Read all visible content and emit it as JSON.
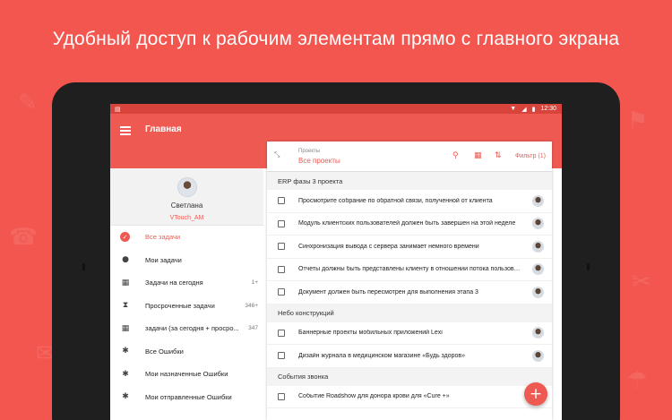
{
  "headline": "Удобный доступ к рабочим элементам прямо с главного экрана",
  "status_bar": {
    "time": "12:30",
    "left_icon": "notification-icon",
    "wifi_icon": "wifi-icon",
    "signal_icon": "signal-icon",
    "battery_icon": "battery-icon"
  },
  "app_bar": {
    "title": "Главная"
  },
  "profile": {
    "name": "Светлана",
    "subtitle": "VTouch_AM"
  },
  "nav": [
    {
      "label": "Все задачи",
      "icon": "check-circle-icon",
      "count": "",
      "active": true
    },
    {
      "label": "Мои задачи",
      "icon": "person-icon",
      "count": ""
    },
    {
      "label": "Задачи на сегодня",
      "icon": "calendar-icon",
      "count": "1+"
    },
    {
      "label": "Просроченные задачи",
      "icon": "hourglass-icon",
      "count": "346+"
    },
    {
      "label": "задачи (за сегодня + просро...",
      "icon": "calendar-check-icon",
      "count": "347"
    },
    {
      "label": "Все Ошибки",
      "icon": "bug-icon",
      "count": ""
    },
    {
      "label": "Мои назначенные Ошибки",
      "icon": "bug-icon",
      "count": ""
    },
    {
      "label": "Мои отправленные Ошибки",
      "icon": "bug-icon",
      "count": ""
    }
  ],
  "panel": {
    "label": "Проекты",
    "value": "Все проекты",
    "filter": "Фильтр (1)",
    "groups": [
      {
        "name": "ERP фазы 3 проекта",
        "tasks": [
          "Просмотрите собрание по обратной связи, полученной от клиента",
          "Модуль клиентских пользователей должен быть завершен на этой неделе",
          "Синхронизация вывода с сервера занимает немного времени",
          "Отчеты должны быть представлены клиенту в отношении потока пользователей",
          "Документ должен быть пересмотрен для выполнения этапа 3"
        ]
      },
      {
        "name": "Небо конструкций",
        "tasks": [
          "Баннерные проекты мобильных приложений Lexi",
          "Дизайн журнала в медицинском магазине «Будь здоров»"
        ]
      },
      {
        "name": "События звонка",
        "tasks": [
          "Событие Roadshow для донора крови для «Cure +»"
        ]
      }
    ]
  },
  "fab_label": "+",
  "colors": {
    "brand": "#ee5a52",
    "background": "#f2564f",
    "status_bar": "#d8443c"
  }
}
